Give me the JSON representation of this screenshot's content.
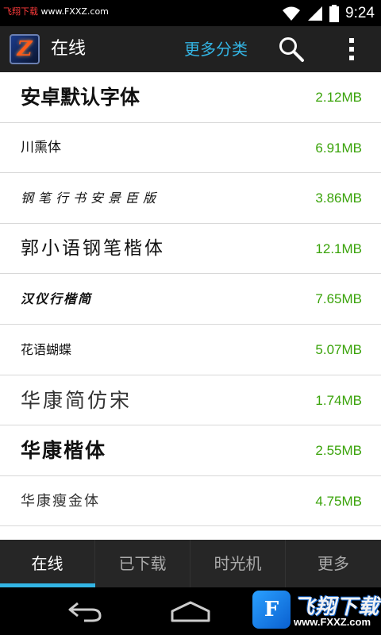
{
  "status_bar": {
    "watermark_prefix": "飞翔下载",
    "watermark_url": " www.FXXZ.com",
    "time": "9:24",
    "icons": [
      "wifi-icon",
      "signal-icon",
      "battery-icon"
    ]
  },
  "action_bar": {
    "title": "在线",
    "more_categories": "更多分类",
    "app_icon_letter": "Z",
    "icons": [
      "app-icon",
      "search-icon",
      "overflow-menu-icon"
    ]
  },
  "fonts": [
    {
      "name": "安卓默认字体",
      "size": "2.12MB"
    },
    {
      "name": "川熏体",
      "size": "6.91MB"
    },
    {
      "name": "钢笔行书安景臣版",
      "size": "3.86MB"
    },
    {
      "name": "郭小语钢笔楷体",
      "size": "12.1MB"
    },
    {
      "name": "汉仪行楷简",
      "size": "7.65MB"
    },
    {
      "name": "花语蝴蝶",
      "size": "5.07MB"
    },
    {
      "name": "华康简仿宋",
      "size": "1.74MB"
    },
    {
      "name": "华康楷体",
      "size": "2.55MB"
    },
    {
      "name": "华康瘦金体",
      "size": "4.75MB"
    }
  ],
  "tabs": [
    {
      "label": "在线",
      "active": true
    },
    {
      "label": "已下载",
      "active": false
    },
    {
      "label": "时光机",
      "active": false
    },
    {
      "label": "更多",
      "active": false
    }
  ],
  "nav_bar": {
    "icons": [
      "back-icon",
      "home-icon"
    ]
  },
  "watermark_badge": {
    "brand": "飞翔下载",
    "url": "www.FXXZ.com"
  },
  "colors": {
    "accent": "#33b5e5",
    "size_text": "#3aa30a",
    "action_bar_bg": "#212121",
    "tab_bar_bg": "#262626"
  }
}
